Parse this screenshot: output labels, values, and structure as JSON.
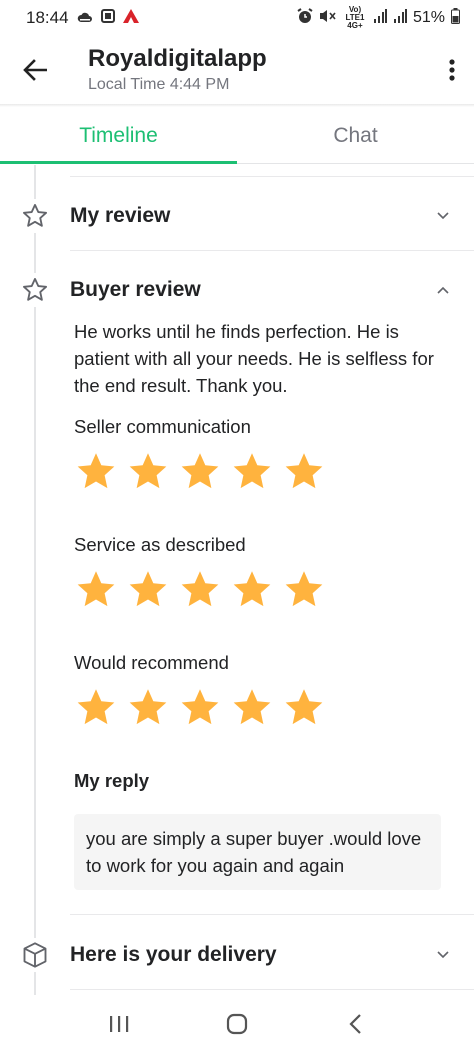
{
  "status_bar": {
    "time": "18:44",
    "network": "Vo) LTE1 4G+",
    "battery": "51%"
  },
  "header": {
    "title": "Royaldigitalapp",
    "subtitle": "Local Time 4:44 PM"
  },
  "tabs": [
    {
      "label": "Timeline",
      "active": true
    },
    {
      "label": "Chat",
      "active": false
    }
  ],
  "sections": {
    "my_review": {
      "title": "My review",
      "expanded": false
    },
    "buyer_review": {
      "title": "Buyer review",
      "expanded": true,
      "text": "He works until he finds perfection. He is patient with all your needs. He is selfless for the end result. Thank you.",
      "ratings": [
        {
          "label": "Seller communication",
          "stars": 5
        },
        {
          "label": "Service as described",
          "stars": 5
        },
        {
          "label": "Would recommend",
          "stars": 5
        }
      ],
      "reply_label": "My reply",
      "reply_text": "you are simply a super buyer .would love to work for you again and again"
    },
    "delivery": {
      "title": "Here is your delivery",
      "expanded": false
    }
  },
  "colors": {
    "accent": "#1dbf73",
    "star": "#ffb33e",
    "text": "#222325",
    "muted": "#74767e"
  }
}
